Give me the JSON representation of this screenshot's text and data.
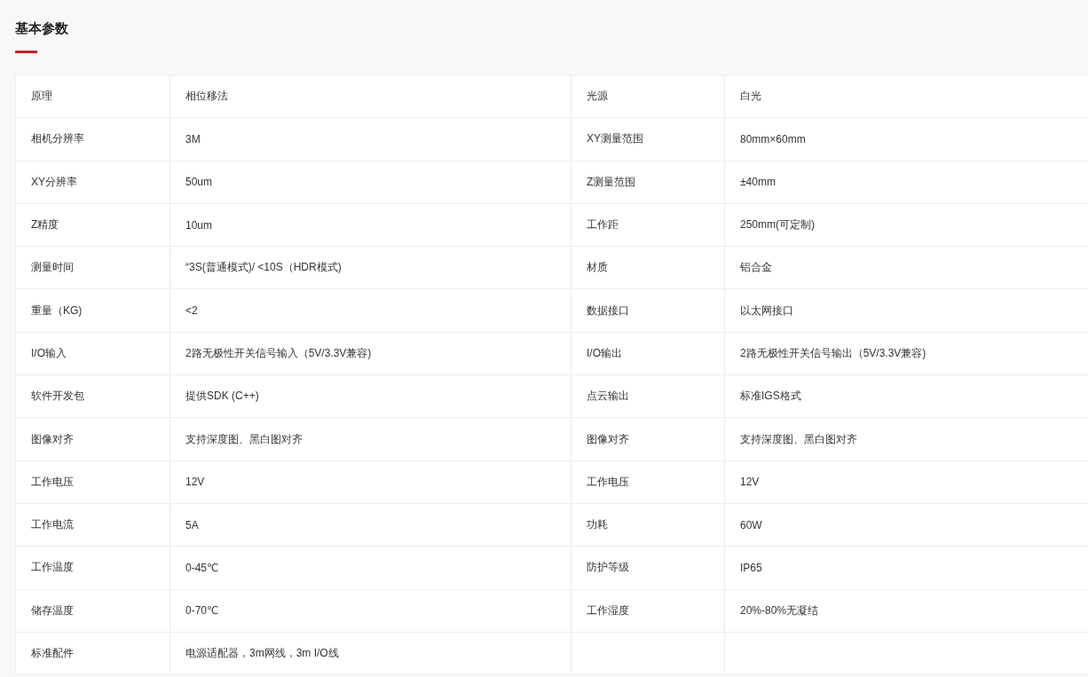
{
  "section_title": "基本参数",
  "rows": [
    {
      "cells": [
        {
          "label": "原理",
          "value": "相位移法"
        },
        {
          "label": "光源",
          "value": "白光"
        }
      ]
    },
    {
      "cells": [
        {
          "label": "相机分辨率",
          "value": "3M"
        },
        {
          "label": "XY测量范围",
          "value": "80mm×60mm"
        }
      ]
    },
    {
      "cells": [
        {
          "label": "XY分辨率",
          "value": "50um"
        },
        {
          "label": "Z测量范围",
          "value": "±40mm"
        }
      ]
    },
    {
      "cells": [
        {
          "label": "Z精度",
          "value": "10um"
        },
        {
          "label": "工作距",
          "value": "250mm(可定制)"
        }
      ]
    },
    {
      "cells": [
        {
          "label": "测量时间",
          "value": "“3S(普通模式)/ <10S（HDR模式)"
        },
        {
          "label": "材质",
          "value": "铝合金"
        }
      ]
    },
    {
      "cells": [
        {
          "label": "重量（KG)",
          "value": "<2"
        },
        {
          "label": "数据接口",
          "value": "以太网接口"
        }
      ]
    },
    {
      "cells": [
        {
          "label": "I/O输入",
          "value": "2路无极性开关信号输入（5V/3.3V兼容)"
        },
        {
          "label": "I/O输出",
          "value": "2路无极性开关信号输出（5V/3.3V兼容)"
        }
      ]
    },
    {
      "cells": [
        {
          "label": "软件开发包",
          "value": "提供SDK (C++)"
        },
        {
          "label": "点云输出",
          "value": "标准IGS格式"
        }
      ]
    },
    {
      "cells": [
        {
          "label": "图像对齐",
          "value": "支持深度图、黑白图对齐"
        },
        {
          "label": "图像对齐",
          "value": "支持深度图、黑白图对齐"
        }
      ]
    },
    {
      "cells": [
        {
          "label": "工作电压",
          "value": "12V"
        },
        {
          "label": "工作电压",
          "value": "12V"
        }
      ]
    },
    {
      "cells": [
        {
          "label": "工作电流",
          "value": "5A"
        },
        {
          "label": "功耗",
          "value": "60W"
        }
      ]
    },
    {
      "cells": [
        {
          "label": "工作温度",
          "value": "0-45℃"
        },
        {
          "label": "防护等级",
          "value": "IP65"
        }
      ]
    },
    {
      "cells": [
        {
          "label": "储存温度",
          "value": "0-70℃"
        },
        {
          "label": "工作湿度",
          "value": "20%-80%无凝结"
        }
      ]
    },
    {
      "cells": [
        {
          "label": "标准配件",
          "value": "电源适配器，3m网线，3m I/O线"
        }
      ]
    }
  ]
}
